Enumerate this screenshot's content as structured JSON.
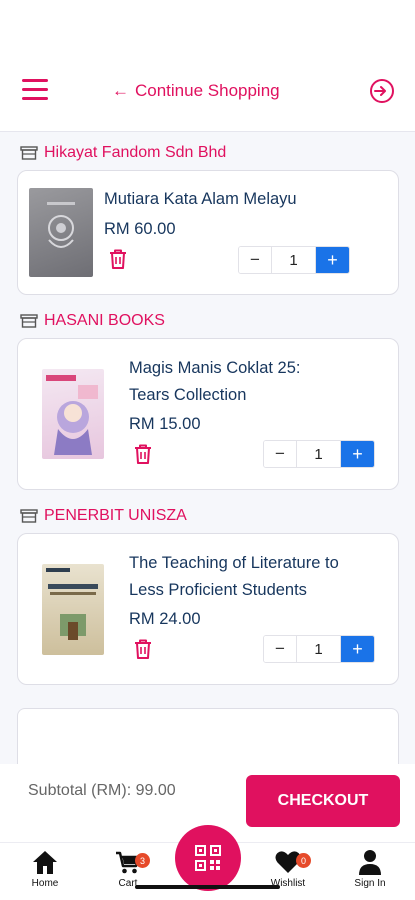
{
  "header": {
    "continue_label": "Continue Shopping",
    "menu_icon": "hamburger-icon",
    "signin_icon": "sign-in-icon"
  },
  "sellers": [
    {
      "name": "Hikayat Fandom Sdn Bhd",
      "items": [
        {
          "title": "Mutiara Kata Alam Melayu",
          "price": "RM 60.00",
          "qty": "1"
        }
      ]
    },
    {
      "name": "HASANI BOOKS",
      "items": [
        {
          "title": "Magis Manis Coklat 25: Tears Collection",
          "price": "RM 15.00",
          "qty": "1"
        }
      ]
    },
    {
      "name": "PENERBIT UNISZA",
      "items": [
        {
          "title": "The Teaching of Literature to Less Proficient Students",
          "price": "RM 24.00",
          "qty": "1"
        }
      ]
    }
  ],
  "qty_controls": {
    "minus": "−",
    "plus": "+"
  },
  "footer": {
    "subtotal": "Subtotal (RM): 99.00",
    "checkout_label": "CHECKOUT"
  },
  "nav": {
    "home": "Home",
    "cart": "Cart",
    "cart_badge": "3",
    "wishlist": "Wishlist",
    "wishlist_badge": "0",
    "signin": "Sign In"
  },
  "colors": {
    "accent": "#e0115f",
    "primary_blue": "#1a73e8",
    "text_dark": "#17365d",
    "badge": "#e64a2a"
  }
}
